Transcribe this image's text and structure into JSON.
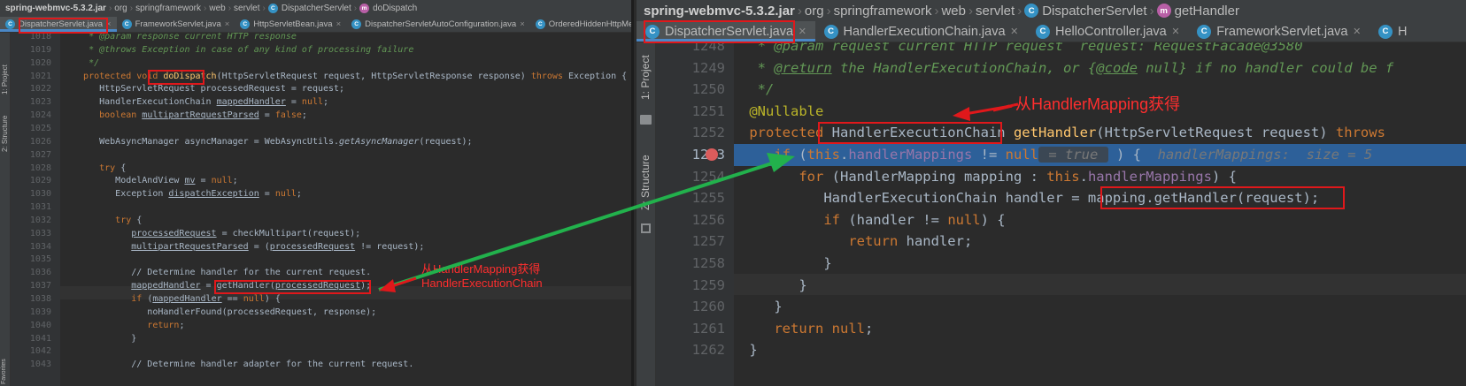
{
  "left_panel": {
    "breadcrumb": [
      "spring-webmvc-5.3.2.jar",
      "org",
      "springframework",
      "web",
      "servlet",
      "DispatcherServlet",
      "doDispatch"
    ],
    "tabs": [
      "DispatcherServlet.java",
      "FrameworkServlet.java",
      "HttpServletBean.java",
      "DispatcherServletAutoConfiguration.java",
      "OrderedHiddenHttpMetho"
    ],
    "side_tools": [
      "1: Project",
      "2: Structure",
      "Favorites"
    ],
    "lines": [
      {
        "n": "1018",
        "t": [
          [
            "cm",
            "    * "
          ],
          [
            "cm it",
            "@param"
          ],
          [
            "cm",
            " response current HTTP response"
          ]
        ]
      },
      {
        "n": "1019",
        "t": [
          [
            "cm",
            "    * "
          ],
          [
            "cm it",
            "@throws"
          ],
          [
            "cm",
            " Exception in case of any kind of processing failure"
          ]
        ]
      },
      {
        "n": "1020",
        "t": [
          [
            "cm",
            "    */"
          ]
        ]
      },
      {
        "n": "1021",
        "t": [
          [
            "kw",
            "   protected void "
          ],
          [
            "fn",
            "doDispatch"
          ],
          [
            "",
            "(HttpServletRequest request, HttpServletResponse response) "
          ],
          [
            "kw",
            "throws"
          ],
          [
            "",
            " Exception {"
          ]
        ]
      },
      {
        "n": "1022",
        "t": [
          [
            "",
            "      HttpServletRequest processedRequest = request;"
          ]
        ]
      },
      {
        "n": "1023",
        "t": [
          [
            "",
            "      HandlerExecutionChain "
          ],
          [
            "ul",
            "mappedHandler"
          ],
          [
            "",
            " = "
          ],
          [
            "kw",
            "null"
          ],
          [
            "",
            ";"
          ]
        ]
      },
      {
        "n": "1024",
        "t": [
          [
            "kw",
            "      boolean "
          ],
          [
            "ul",
            "multipartRequestParsed"
          ],
          [
            "",
            " = "
          ],
          [
            "kw",
            "false"
          ],
          [
            "",
            ";"
          ]
        ]
      },
      {
        "n": "1025",
        "t": [
          [
            "",
            ""
          ]
        ]
      },
      {
        "n": "1026",
        "t": [
          [
            "",
            "      WebAsyncManager asyncManager = WebAsyncUtils."
          ],
          [
            "it",
            "getAsyncManager"
          ],
          [
            "",
            "(request);"
          ]
        ]
      },
      {
        "n": "1027",
        "t": [
          [
            "",
            ""
          ]
        ]
      },
      {
        "n": "1028",
        "t": [
          [
            "kw",
            "      try"
          ],
          [
            "",
            " {"
          ]
        ]
      },
      {
        "n": "1029",
        "t": [
          [
            "",
            "         ModelAndView "
          ],
          [
            "ul",
            "mv"
          ],
          [
            "",
            " = "
          ],
          [
            "kw",
            "null"
          ],
          [
            "",
            ";"
          ]
        ]
      },
      {
        "n": "1030",
        "t": [
          [
            "",
            "         Exception "
          ],
          [
            "ul",
            "dispatchException"
          ],
          [
            "",
            " = "
          ],
          [
            "kw",
            "null"
          ],
          [
            "",
            ";"
          ]
        ]
      },
      {
        "n": "1031",
        "t": [
          [
            "",
            ""
          ]
        ]
      },
      {
        "n": "1032",
        "t": [
          [
            "kw",
            "         try"
          ],
          [
            "",
            " {"
          ]
        ]
      },
      {
        "n": "1033",
        "t": [
          [
            "",
            "            "
          ],
          [
            "ul",
            "processedRequest"
          ],
          [
            "",
            " = checkMultipart(request);"
          ]
        ]
      },
      {
        "n": "1034",
        "t": [
          [
            "",
            "            "
          ],
          [
            "ul",
            "multipartRequestParsed"
          ],
          [
            "",
            " = ("
          ],
          [
            "ul",
            "processedRequest"
          ],
          [
            "",
            " != request);"
          ]
        ]
      },
      {
        "n": "1035",
        "t": [
          [
            "",
            ""
          ]
        ]
      },
      {
        "n": "1036",
        "t": [
          [
            "",
            "            // Determine handler for the current request."
          ]
        ]
      },
      {
        "n": "1037",
        "t": [
          [
            "",
            "            "
          ],
          [
            "ul",
            "mappedHandler"
          ],
          [
            "",
            " = getHandler("
          ],
          [
            "ul",
            "processedRequest"
          ],
          [
            "",
            ");"
          ]
        ]
      },
      {
        "n": "1038",
        "t": [
          [
            "kw",
            "            if"
          ],
          [
            "",
            " ("
          ],
          [
            "ul",
            "mappedHandler"
          ],
          [
            "",
            " == "
          ],
          [
            "kw",
            "null"
          ],
          [
            "",
            ") {"
          ]
        ]
      },
      {
        "n": "1039",
        "t": [
          [
            "",
            "               noHandlerFound(processedRequest, response);"
          ]
        ]
      },
      {
        "n": "1040",
        "t": [
          [
            "kw",
            "               return"
          ],
          [
            "",
            ";"
          ]
        ]
      },
      {
        "n": "1041",
        "t": [
          [
            "",
            "            }"
          ]
        ]
      },
      {
        "n": "1042",
        "t": [
          [
            "",
            ""
          ]
        ]
      },
      {
        "n": "1043",
        "t": [
          [
            "",
            "            // Determine handler adapter for the current request."
          ]
        ]
      }
    ],
    "annotation_line1": "从HandlerMapping获得",
    "annotation_line2": "HandlerExecutionChain"
  },
  "right_panel": {
    "breadcrumb": [
      "spring-webmvc-5.3.2.jar",
      "org",
      "springframework",
      "web",
      "servlet",
      "DispatcherServlet",
      "getHandler"
    ],
    "tabs": [
      "DispatcherServlet.java",
      "HandlerExecutionChain.java",
      "HelloController.java",
      "FrameworkServlet.java",
      "H"
    ],
    "side_tools": [
      "1: Project",
      "Z: Structure"
    ],
    "lines": [
      {
        "n": "1248",
        "t": [
          [
            "cm",
            "  * "
          ],
          [
            "cm it",
            "@param"
          ],
          [
            "cm",
            " request current HTTP request  request: RequestFacade@3580"
          ]
        ]
      },
      {
        "n": "1249",
        "t": [
          [
            "cm",
            "  * "
          ],
          [
            "cm it ul",
            "@return"
          ],
          [
            "cm",
            " the HandlerExecutionChain, or {"
          ],
          [
            "cm it ul",
            "@code"
          ],
          [
            "cm",
            " null} if no handler could be f"
          ]
        ]
      },
      {
        "n": "1250",
        "t": [
          [
            "cm",
            "  */"
          ]
        ]
      },
      {
        "n": "1251",
        "t": [
          [
            "ann",
            " @Nullable"
          ]
        ]
      },
      {
        "n": "1252",
        "t": [
          [
            "kw",
            " protected "
          ],
          [
            "",
            "HandlerExecutionChain "
          ],
          [
            "fn",
            "getHandler"
          ],
          [
            "",
            "(HttpServletRequest request) "
          ],
          [
            "kw",
            "throws"
          ]
        ]
      },
      {
        "n": "1253",
        "t": [
          [
            "kw",
            "    if"
          ],
          [
            "",
            " ("
          ],
          [
            "kw",
            "this"
          ],
          [
            "",
            "."
          ],
          [
            "fld",
            "handlerMappings"
          ],
          [
            "",
            " != "
          ],
          [
            "kw",
            "null"
          ],
          [
            "hint",
            " = true "
          ],
          [
            "",
            " ) {  "
          ],
          [
            "hint",
            "handlerMappings:  size = 5"
          ]
        ]
      },
      {
        "n": "1254",
        "t": [
          [
            "kw",
            "       for"
          ],
          [
            "",
            " (HandlerMapping mapping : "
          ],
          [
            "kw",
            "this"
          ],
          [
            "",
            "."
          ],
          [
            "fld",
            "handlerMappings"
          ],
          [
            "",
            ") {"
          ]
        ]
      },
      {
        "n": "1255",
        "t": [
          [
            "",
            "          HandlerExecutionChain handler = mapping.getHandler(request);"
          ]
        ]
      },
      {
        "n": "1256",
        "t": [
          [
            "kw",
            "          if"
          ],
          [
            "",
            " (handler != "
          ],
          [
            "kw",
            "null"
          ],
          [
            "",
            ") {"
          ]
        ]
      },
      {
        "n": "1257",
        "t": [
          [
            "kw",
            "             return"
          ],
          [
            "",
            " handler;"
          ]
        ]
      },
      {
        "n": "1258",
        "t": [
          [
            "",
            "          }"
          ]
        ]
      },
      {
        "n": "1259",
        "t": [
          [
            "",
            "       }"
          ]
        ]
      },
      {
        "n": "1260",
        "t": [
          [
            "",
            "    }"
          ]
        ]
      },
      {
        "n": "1261",
        "t": [
          [
            "kw",
            "    return null"
          ],
          [
            "",
            ";"
          ]
        ]
      },
      {
        "n": "1262",
        "t": [
          [
            "",
            " }"
          ]
        ]
      }
    ],
    "annotation": "从HandlerMapping获得"
  },
  "colors": {
    "arrow_green": "#22b14c",
    "annotation_red": "#e0181b",
    "exec_line": "#2d6099",
    "selection_blue": "#4a88c7"
  }
}
